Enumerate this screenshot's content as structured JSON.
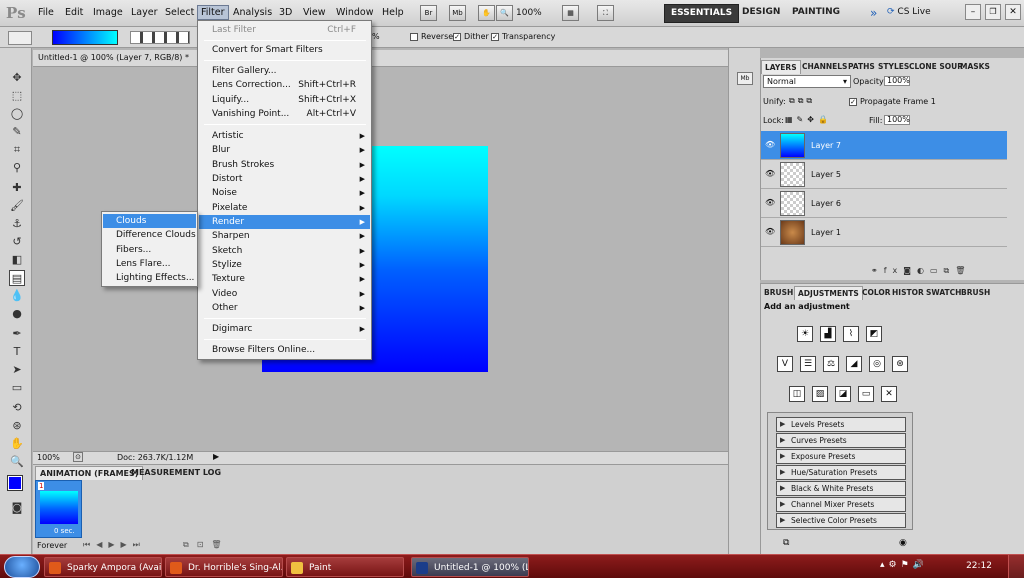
{
  "app": {
    "logo": "Ps"
  },
  "menubar": {
    "items": [
      "File",
      "Edit",
      "Image",
      "Layer",
      "Select",
      "Filter",
      "Analysis",
      "3D",
      "View",
      "Window",
      "Help"
    ],
    "active": "Filter",
    "zoom": "100%",
    "workspaces": [
      "ESSENTIALS",
      "DESIGN",
      "PAINTING"
    ],
    "cslive": "CS Live"
  },
  "optionsbar": {
    "zoom_partial": "%",
    "reverse_label": "Reverse",
    "dither_label": "Dither",
    "transparency_label": "Transparency"
  },
  "document": {
    "tab_title": "Untitled-1 @ 100% (Layer 7, RGB/8) *",
    "status_zoom": "100%",
    "status_doc": "Doc: 263.7K/1.12M"
  },
  "animation": {
    "tabs": [
      "ANIMATION (FRAMES)",
      "MEASUREMENT LOG"
    ],
    "frame_number": "1",
    "frame_delay": "0 sec.",
    "loop": "Forever"
  },
  "layers_panel": {
    "tabs": [
      "LAYERS",
      "CHANNELS",
      "PATHS",
      "STYLES",
      "CLONE SOUR",
      "MASKS"
    ],
    "blend_mode": "Normal",
    "opacity_label": "Opacity:",
    "opacity_value": "100%",
    "unify_label": "Unify:",
    "propagate_label": "Propagate Frame 1",
    "lock_label": "Lock:",
    "fill_label": "Fill:",
    "fill_value": "100%",
    "layers": [
      {
        "name": "Layer 7",
        "selected": true
      },
      {
        "name": "Layer 5",
        "selected": false
      },
      {
        "name": "Layer 6",
        "selected": false
      },
      {
        "name": "Layer 1",
        "selected": false
      }
    ]
  },
  "adjustments_panel": {
    "tabs": [
      "BRUSH",
      "ADJUSTMENTS",
      "COLOR",
      "HISTOR",
      "SWATCH",
      "BRUSH"
    ],
    "heading": "Add an adjustment",
    "presets": [
      "Levels Presets",
      "Curves Presets",
      "Exposure Presets",
      "Hue/Saturation Presets",
      "Black & White Presets",
      "Channel Mixer Presets",
      "Selective Color Presets"
    ]
  },
  "filter_menu": {
    "items": [
      {
        "label": "Last Filter",
        "shortcut": "Ctrl+F",
        "disabled": true
      },
      {
        "label": "Convert for Smart Filters"
      },
      {
        "label": "Filter Gallery..."
      },
      {
        "label": "Lens Correction...",
        "shortcut": "Shift+Ctrl+R"
      },
      {
        "label": "Liquify...",
        "shortcut": "Shift+Ctrl+X"
      },
      {
        "label": "Vanishing Point...",
        "shortcut": "Alt+Ctrl+V"
      },
      {
        "label": "Artistic"
      },
      {
        "label": "Blur"
      },
      {
        "label": "Brush Strokes"
      },
      {
        "label": "Distort"
      },
      {
        "label": "Noise"
      },
      {
        "label": "Pixelate"
      },
      {
        "label": "Render"
      },
      {
        "label": "Sharpen"
      },
      {
        "label": "Sketch"
      },
      {
        "label": "Stylize"
      },
      {
        "label": "Texture"
      },
      {
        "label": "Video"
      },
      {
        "label": "Other"
      },
      {
        "label": "Digimarc"
      },
      {
        "label": "Browse Filters Online..."
      }
    ]
  },
  "render_submenu": {
    "items": [
      "Clouds",
      "Difference Clouds",
      "Fibers...",
      "Lens Flare...",
      "Lighting Effects..."
    ]
  },
  "taskbar": {
    "tasks": [
      "Sparky Ampora (Avai...",
      "Dr. Horrible's Sing-Al...",
      "Paint",
      "Untitled-1 @ 100% (L..."
    ],
    "clock": "22:12"
  },
  "colors": {
    "accent": "#3d8ee6",
    "gradient_top": "#00ffff",
    "gradient_bottom": "#0000ff",
    "taskbar": "#7a1515"
  }
}
